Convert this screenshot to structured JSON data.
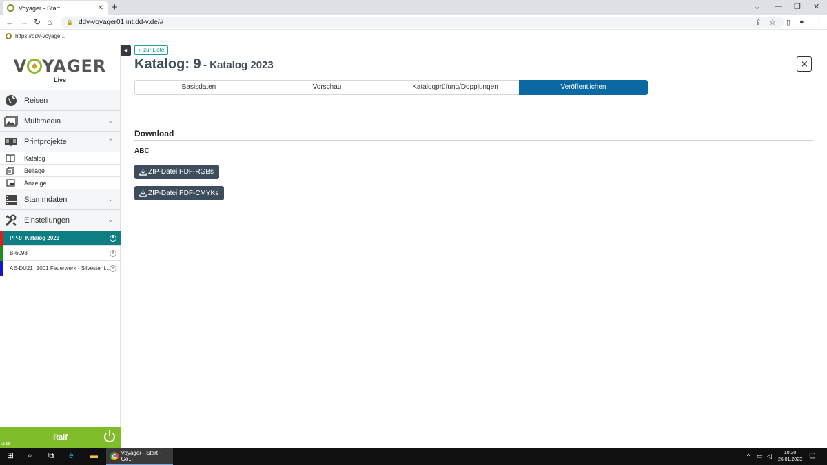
{
  "browser": {
    "tab_title": "Voyager - Start",
    "url": "ddv-voyager01.int.dd-v.de/#",
    "bookmark": "https://ddv-voyage..."
  },
  "sidebar": {
    "logo_text": "VOYAGER",
    "logo_sub": "Live",
    "menu": [
      {
        "label": "Reisen",
        "icon": "globe-icon"
      },
      {
        "label": "Multimedia",
        "icon": "images-icon"
      },
      {
        "label": "Printprojekte",
        "icon": "book-icon"
      },
      {
        "label": "Stammdaten",
        "icon": "database-icon"
      },
      {
        "label": "Einstellungen",
        "icon": "tools-icon"
      }
    ],
    "subitems": [
      {
        "label": "Katalog",
        "icon": "open-book-icon"
      },
      {
        "label": "Beilage",
        "icon": "copy-icon"
      },
      {
        "label": "Anzeige",
        "icon": "picture-in-picture-icon"
      }
    ],
    "open_items": [
      {
        "code": "PP-9",
        "name": "Katalog 2023",
        "color": "#e21b1b"
      },
      {
        "code": "B-6098",
        "name": "",
        "color": "#1e8f1e"
      },
      {
        "code": "AE-DU21",
        "name": "1001 Feuerwerk - Silvester i...",
        "color": "#1414d8"
      }
    ],
    "user": "Ralf",
    "version": "v1.58"
  },
  "main": {
    "back_label": "zur Liste",
    "title": "Katalog: 9",
    "subtitle": "- Katalog 2023",
    "tabs": [
      "Basisdaten",
      "Vorschau",
      "Katalogprüfung/Dopplungen",
      "Veröffentlichen"
    ],
    "active_tab": "Veröffentlichen",
    "download_heading": "Download",
    "group_label": "ABC",
    "buttons": [
      "ZIP-Datei PDF-RGBs",
      "ZIP-Datei PDF-CMYKs"
    ]
  },
  "taskbar": {
    "app_label": "Voyager - Start - Go...",
    "time": "10:20",
    "date": "26.01.2023"
  },
  "colors": {
    "accent": "#0a68a3",
    "active_item": "#0d7f84",
    "user_bar": "#7fbe2a",
    "button_dark": "#3d4d5b"
  }
}
